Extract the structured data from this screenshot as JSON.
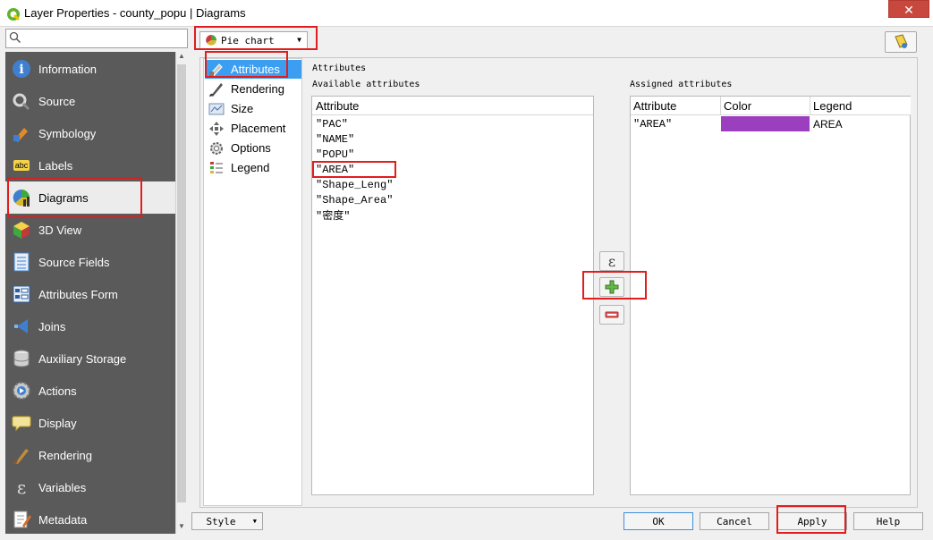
{
  "window": {
    "title": "Layer Properties - county_popu | Diagrams",
    "close_glyph": "✕"
  },
  "search": {
    "placeholder": ""
  },
  "sidebar": {
    "items": [
      {
        "label": "Information",
        "icon": "information-icon"
      },
      {
        "label": "Source",
        "icon": "source-icon"
      },
      {
        "label": "Symbology",
        "icon": "symbology-icon"
      },
      {
        "label": "Labels",
        "icon": "labels-icon",
        "icon_text": "abc"
      },
      {
        "label": "Diagrams",
        "icon": "diagrams-icon",
        "selected": true
      },
      {
        "label": "3D View",
        "icon": "3d-view-icon"
      },
      {
        "label": "Source Fields",
        "icon": "source-fields-icon"
      },
      {
        "label": "Attributes Form",
        "icon": "attributes-form-icon"
      },
      {
        "label": "Joins",
        "icon": "joins-icon"
      },
      {
        "label": "Auxiliary Storage",
        "icon": "auxiliary-storage-icon"
      },
      {
        "label": "Actions",
        "icon": "actions-icon"
      },
      {
        "label": "Display",
        "icon": "display-icon"
      },
      {
        "label": "Rendering",
        "icon": "rendering-icon"
      },
      {
        "label": "Variables",
        "icon": "variables-icon",
        "icon_text": "ε"
      },
      {
        "label": "Metadata",
        "icon": "metadata-icon"
      }
    ]
  },
  "diagram_type": {
    "selected": "Pie chart"
  },
  "tabs": [
    {
      "label": "Attributes",
      "icon": "attributes-tab-icon",
      "selected": true
    },
    {
      "label": "Rendering",
      "icon": "rendering-tab-icon"
    },
    {
      "label": "Size",
      "icon": "size-tab-icon"
    },
    {
      "label": "Placement",
      "icon": "placement-tab-icon"
    },
    {
      "label": "Options",
      "icon": "options-tab-icon"
    },
    {
      "label": "Legend",
      "icon": "legend-tab-icon"
    }
  ],
  "attributes_panel": {
    "group_title": "Attributes",
    "available_title": "Available attributes",
    "assigned_title": "Assigned attributes",
    "available_header": "Attribute",
    "available": [
      "\"PAC\"",
      "\"NAME\"",
      "\"POPU\"",
      "\"AREA\"",
      "\"Shape_Leng\"",
      "\"Shape_Area\"",
      "\"密度\""
    ],
    "assigned_headers": [
      "Attribute",
      "Color",
      "Legend"
    ],
    "assigned_rows": [
      {
        "attribute": "\"AREA\"",
        "color": "#9b3fbf",
        "legend": "AREA"
      }
    ],
    "expression_glyph": "ε"
  },
  "buttons": {
    "style": "Style",
    "ok": "OK",
    "cancel": "Cancel",
    "apply": "Apply",
    "help": "Help"
  },
  "colors": {
    "sidebar_bg": "#5a5a5a",
    "tab_selected": "#3b9ef0",
    "highlight": "#e11d1d",
    "assigned_color": "#9b3fbf"
  }
}
